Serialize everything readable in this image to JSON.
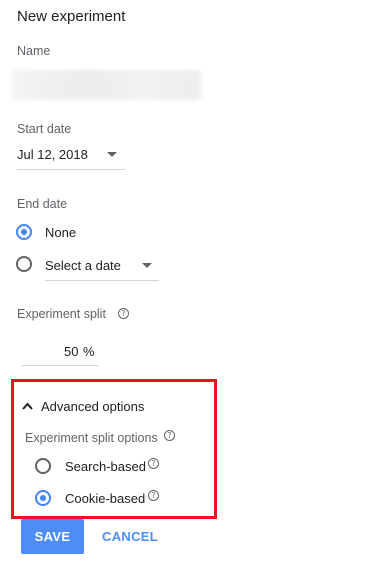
{
  "panel": {
    "title": "New experiment"
  },
  "name": {
    "label": "Name",
    "value": ""
  },
  "start_date": {
    "label": "Start date",
    "value": "Jul 12, 2018"
  },
  "end_date": {
    "label": "End date",
    "options": [
      {
        "label": "None",
        "selected": true
      },
      {
        "label": "Select a date",
        "selected": false
      }
    ]
  },
  "experiment_split": {
    "label": "Experiment split",
    "value": "50",
    "unit": "%"
  },
  "advanced": {
    "toggle_label": "Advanced options",
    "split_options_label": "Experiment split options",
    "options": [
      {
        "label": "Search-based",
        "selected": false
      },
      {
        "label": "Cookie-based",
        "selected": true
      }
    ]
  },
  "actions": {
    "save_label": "SAVE",
    "cancel_label": "CANCEL"
  },
  "colors": {
    "accent": "#4285f4",
    "highlight_box": "#e8141f"
  }
}
